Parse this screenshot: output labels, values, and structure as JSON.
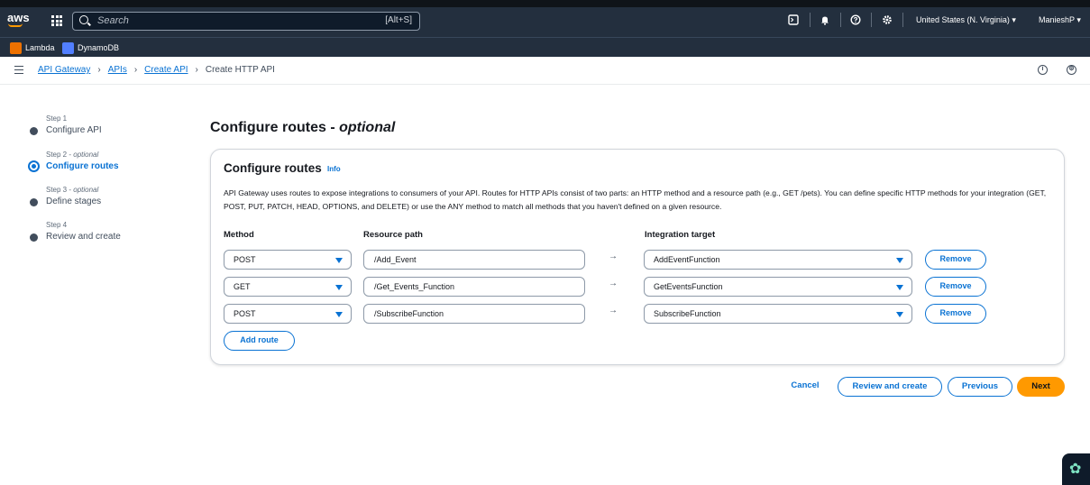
{
  "topbar": {
    "logo": "aws",
    "search_placeholder": "Search",
    "search_shortcut": "[Alt+S]",
    "icons": [
      "cloudshell-icon",
      "bell-icon",
      "help-icon",
      "gear-icon"
    ],
    "region": "United States (N. Virginia) ▾",
    "user": "ManieshP ▾"
  },
  "favorites": [
    {
      "label": "Lambda",
      "color": "#ed7100"
    },
    {
      "label": "DynamoDB",
      "color": "#527fff"
    }
  ],
  "breadcrumb": {
    "items": [
      "API Gateway",
      "APIs",
      "Create API"
    ],
    "current": "Create HTTP API"
  },
  "steps": [
    {
      "step": "Step 1",
      "optional": "",
      "title": "Configure API"
    },
    {
      "step": "Step 2 - ",
      "optional": "optional",
      "title": "Configure routes"
    },
    {
      "step": "Step 3 - ",
      "optional": "optional",
      "title": "Define stages"
    },
    {
      "step": "Step 4",
      "optional": "",
      "title": "Review and create"
    }
  ],
  "page": {
    "title": "Configure routes - ",
    "title_italic": "optional"
  },
  "panel": {
    "title": "Configure routes",
    "info": "Info",
    "description": "API Gateway uses routes to expose integrations to consumers of your API. Routes for HTTP APIs consist of two parts: an HTTP method and a resource path (e.g., GET /pets). You can define specific HTTP methods for your integration (GET, POST, PUT, PATCH, HEAD, OPTIONS, and DELETE) or use the ANY method to match all methods that you haven't defined on a given resource.",
    "headers": {
      "method": "Method",
      "path": "Resource path",
      "target": "Integration target"
    },
    "routes": [
      {
        "method": "POST",
        "path": "/Add_Event",
        "target": "AddEventFunction",
        "remove": "Remove"
      },
      {
        "method": "GET",
        "path": "/Get_Events_Function",
        "target": "GetEventsFunction",
        "remove": "Remove"
      },
      {
        "method": "POST",
        "path": "/SubscribeFunction",
        "target": "SubscribeFunction",
        "remove": "Remove"
      }
    ],
    "add_route": "Add route",
    "arrow": "→"
  },
  "footer": {
    "cancel": "Cancel",
    "review": "Review and create",
    "previous": "Previous",
    "next": "Next"
  },
  "colors": {
    "link": "#0972d3",
    "primary": "#ff9900",
    "nav": "#232f3e"
  }
}
